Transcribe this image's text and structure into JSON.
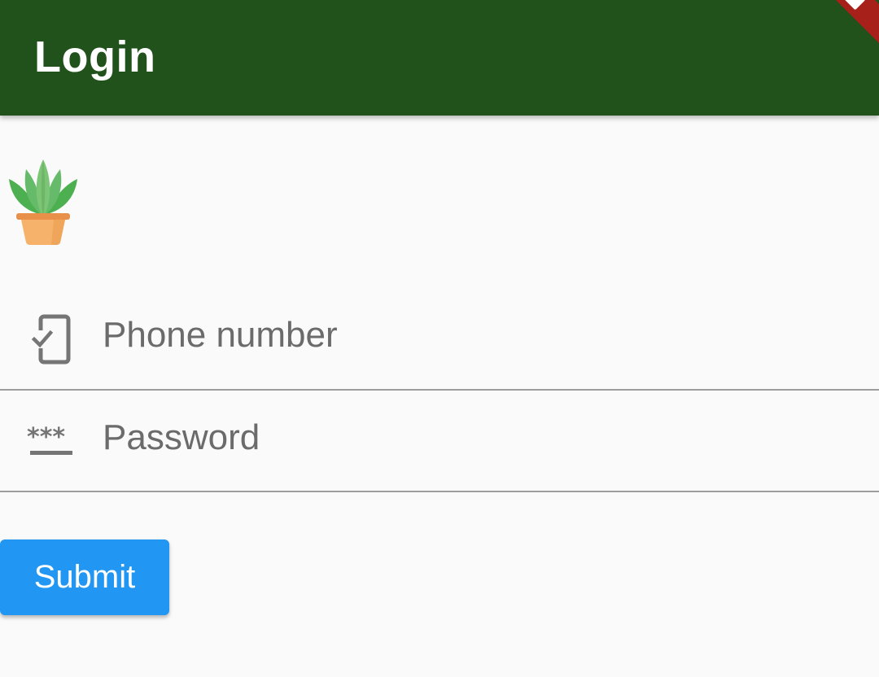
{
  "app_bar": {
    "title": "Login",
    "background_color": "#21521b",
    "debug_banner_color": "#a8201a"
  },
  "logo": {
    "icon": "potted-plant-icon"
  },
  "form": {
    "phone_field": {
      "icon": "phone-check-icon",
      "placeholder": "Phone number",
      "value": ""
    },
    "password_field": {
      "icon": "password-icon",
      "placeholder": "Password",
      "value": ""
    },
    "submit_label": "Submit",
    "submit_color": "#2196f3"
  }
}
